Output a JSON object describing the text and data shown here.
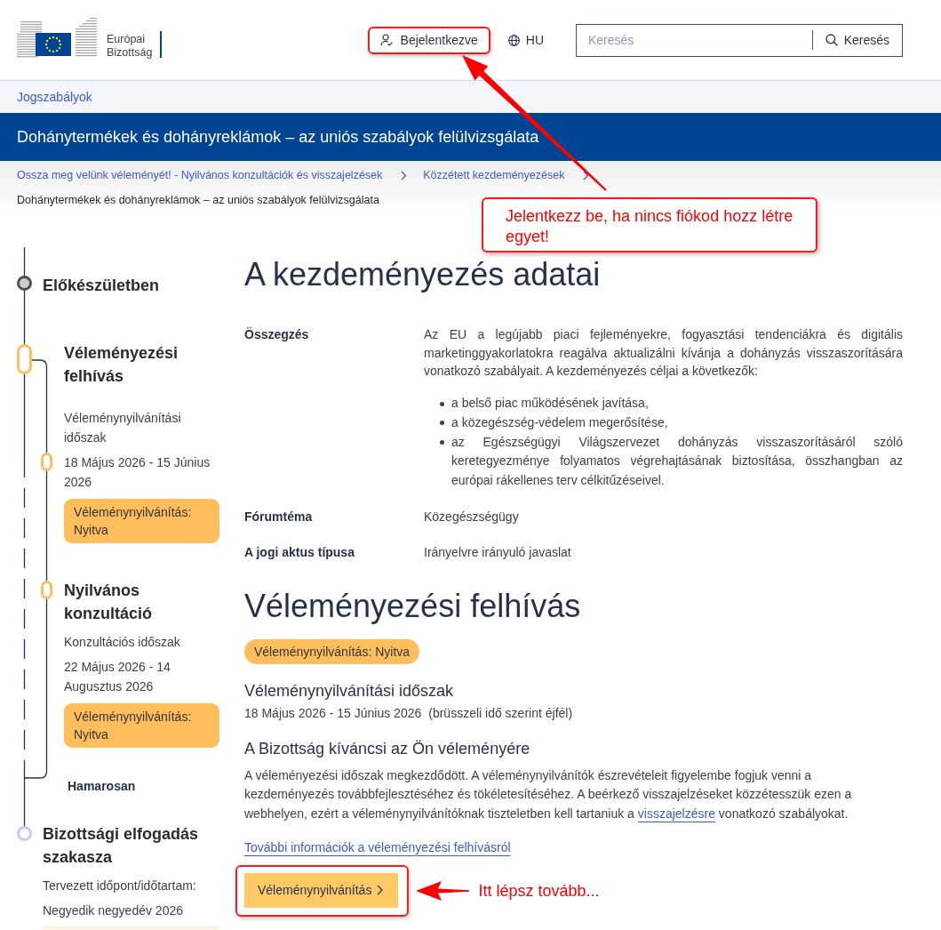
{
  "header": {
    "logo": {
      "line_1": "Európai",
      "line_2": "Bizottság"
    },
    "login": {
      "label": "Bejelentkezve",
      "highlighted": true
    },
    "language": {
      "label": "HU"
    },
    "search": {
      "placeholder": "Keresés",
      "button": "Keresés"
    }
  },
  "nav": {
    "link": "Jogszabályok"
  },
  "title_bar": {
    "title": "Dohánytermékek és dohányreklámok – az uniós szabályok felülvizsgálata"
  },
  "breadcrumbs": [
    {
      "label": "Ossza meg velünk véleményét! - Nyilvános konzultációk és visszajelzések",
      "current": false
    },
    {
      "label": "Közzétett kezdeményezések",
      "current": false
    },
    {
      "label": "Dohánytermékek és dohányreklámok – az uniós szabályok felülvizsgálata",
      "current": true
    }
  ],
  "timeline": [
    {
      "kind": "stage",
      "completed": true,
      "active": false,
      "title": "Előkészületben"
    },
    {
      "kind": "stage",
      "completed": false,
      "active": true,
      "title": "Véleményezési felhívás",
      "children": [
        {
          "kind": "period",
          "active": true,
          "label": "Véleménynyilvánítási időszak",
          "dates": "18 Május 2026 - 15 Június 2026",
          "badge": {
            "text": "Véleménynyilvánítás: Nyitva",
            "faded": false
          }
        },
        {
          "kind": "substage",
          "active": true,
          "title": "Nyilvános konzultáció",
          "label": "Konzultációs időszak",
          "dates": "22 Május 2026 - 14 Augusztus 2026",
          "badge": {
            "text": "Véleménynyilvánítás: Nyitva",
            "faded": false
          }
        }
      ]
    },
    {
      "kind": "note",
      "text": "Hamarosan"
    },
    {
      "kind": "stage",
      "completed": false,
      "active": false,
      "title": "Bizottsági elfogadás szakasza",
      "label": "Tervezett időpont/időtartam:",
      "dates": "Negyedik negyedév 2026",
      "badge": {
        "faded": true
      }
    }
  ],
  "details": {
    "title": "A kezdeményezés adatai",
    "rows": [
      {
        "label": "Összegzés",
        "text": "Az EU a legújabb piaci fejleményekre, fogyasztási tendenciákra és digitális marketinggyakorlatokra reagálva aktualizálni kívánja a dohányzás visszaszorítására vonatkozó szabályait. A kezdeményezés céljai a következők:",
        "bullets": [
          "a belső piac működésének javítása,",
          "a közegészség-védelem megerősítése,",
          "az Egészségügyi Világszervezet dohányzás visszaszorításáról szóló keretegyezménye folyamatos végrehajtásának biztosítása, összhangban az európai rákellenes terv célkitűzéseivel."
        ]
      },
      {
        "label": "Fórumtéma",
        "text": "Közegészségügy"
      },
      {
        "label": "A jogi aktus típusa",
        "text": "Irányelvre irányuló javaslat"
      }
    ]
  },
  "feedback": {
    "title": "Véleményezési felhívás",
    "status_badge": "Véleménynyilvánítás: Nyitva",
    "period": {
      "title": "Véleménynyilvánítási időszak",
      "dates": "18 Május 2026 - 15 Június 2026",
      "note": "(brüsszeli idő szerint éjfél)"
    },
    "intro": {
      "title": "A Bizottság kíváncsi az Ön véleményére",
      "text_before": "A véleményezési időszak megkezdődött. A véleménynyilvánítók észrevételeit figyelembe fogjuk venni a kezdeményezés továbbfejlesztéséhez és tökéletesítéséhez. A beérkező visszajelzéseket közzétesszük ezen a webhelyen, ezért a véleménynyilvánítóknak tiszteletben kell tartaniuk a",
      "link": "visszajelzésre",
      "text_after": "vonatkozó szabályokat."
    },
    "more_link": "További információk a véleményezési felhívásról",
    "button": {
      "label": "Véleménynyilvánítás",
      "highlighted": true
    }
  },
  "annotations": [
    {
      "kind": "callout",
      "text": "Jelentkezz be, ha nincs fiókod hozz létre egyet!"
    },
    {
      "kind": "pointer",
      "text": "Itt lépsz tovább..."
    }
  ]
}
